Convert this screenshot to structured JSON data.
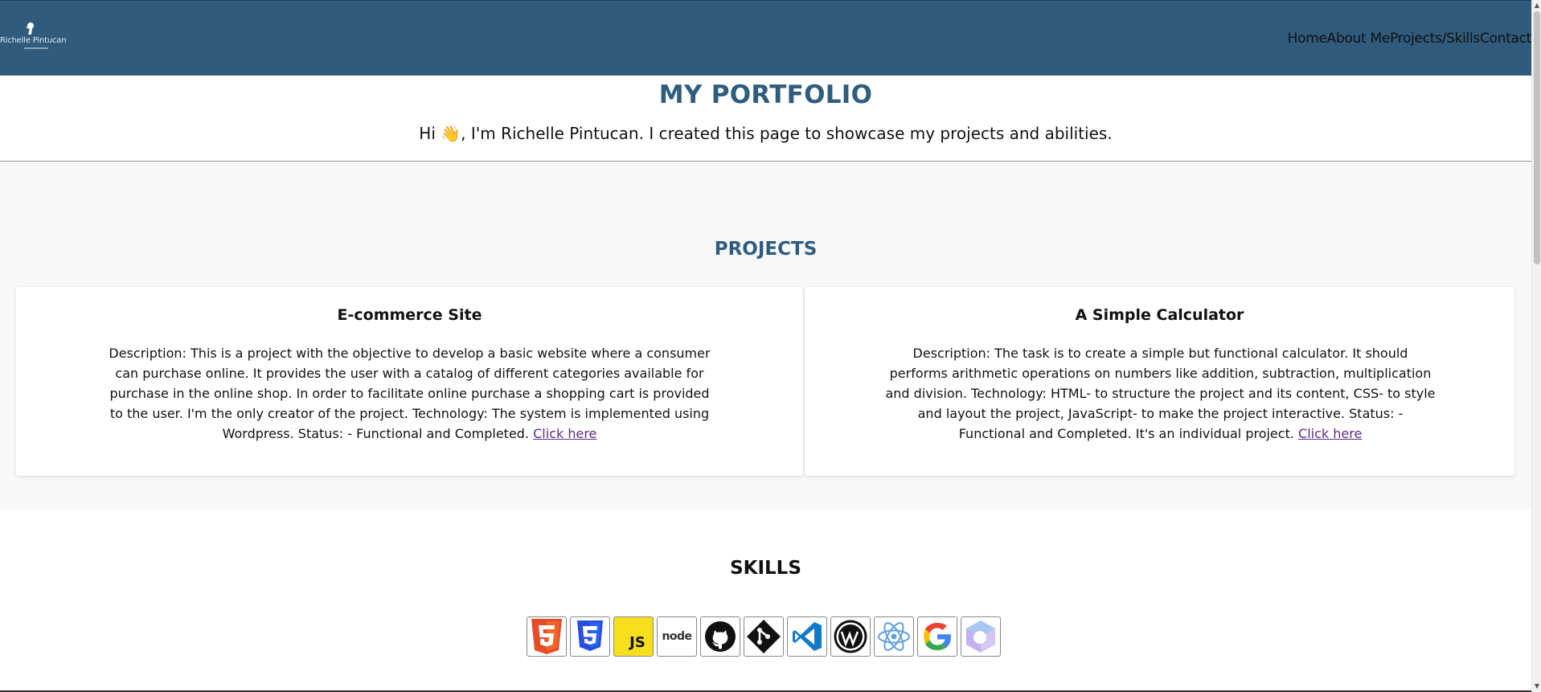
{
  "header": {
    "logo_text": "Richelle Pintucan",
    "nav": [
      "Home",
      "About Me",
      "Projects/Skills",
      "Contact"
    ]
  },
  "hero": {
    "title": "MY PORTFOLIO",
    "intro": "Hi 👋, I'm Richelle Pintucan. I created this page to showcase my projects and abilities."
  },
  "projects": {
    "heading": "PROJECTS",
    "items": [
      {
        "title": "E-commerce Site",
        "description": "Description: This is a project with the objective to develop a basic website where a consumer can purchase online. It provides the user with a catalog of different categories available for purchase in the online shop. In order to facilitate online purchase a shopping cart is provided to the user. I'm the only creator of the project. Technology: The system is implemented using Wordpress. Status: - Functional and Completed.",
        "link_text": "Click here"
      },
      {
        "title": "A Simple Calculator",
        "description": "Description: The task is to create a simple but functional calculator. It should performs arithmetic operations on numbers like addition, subtraction, multiplication and division. Technology: HTML- to structure the project and its content, CSS- to style and layout the project, JavaScript- to make the project interactive. Status: - Functional and Completed. It's an individual project.",
        "link_text": "Click here"
      }
    ]
  },
  "skills": {
    "heading": "SKILLS",
    "icons": [
      "html5-icon",
      "css3-icon",
      "javascript-icon",
      "nodejs-icon",
      "github-icon",
      "git-icon",
      "vscode-icon",
      "wordpress-icon",
      "react-icon",
      "google-icon",
      "power-apps-icon"
    ],
    "labels": {
      "javascript": "JS",
      "nodejs": "node"
    }
  },
  "colors": {
    "navbar": "#305b7c",
    "accent": "#2f5d7e",
    "link": "#5b2a86"
  }
}
